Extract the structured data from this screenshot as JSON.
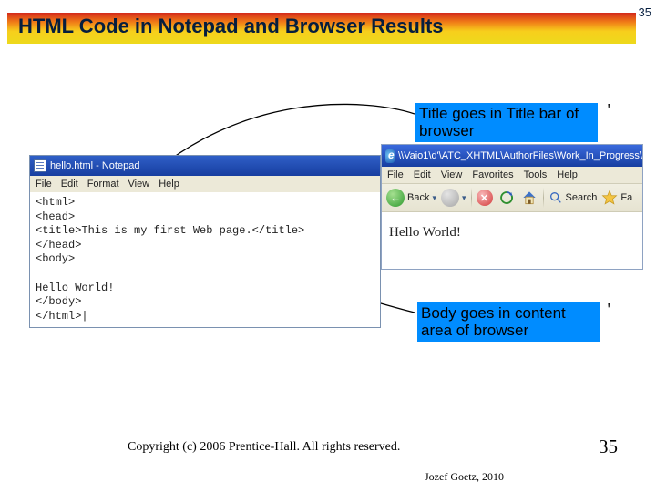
{
  "header": {
    "title": "HTML Code in Notepad and Browser Results",
    "page_number_top": "35"
  },
  "callouts": {
    "title_bar": "Title goes in Title bar of browser",
    "body_area": "Body goes in content area of browser"
  },
  "notepad": {
    "window_title": "hello.html - Notepad",
    "menu": {
      "file": "File",
      "edit": "Edit",
      "format": "Format",
      "view": "View",
      "help": "Help"
    },
    "code": "<html>\n<head>\n<title>This is my first Web page.</title>\n</head>\n<body>\n\nHello World!\n</body>\n</html>|"
  },
  "browser": {
    "address_bar": "\\\\Vaio1\\d'\\ATC_XHTML\\AuthorFiles\\Work_In_Progress\\",
    "menu": {
      "file": "File",
      "edit": "Edit",
      "view": "View",
      "favorites": "Favorites",
      "tools": "Tools",
      "help": "Help"
    },
    "toolbar": {
      "back": "Back",
      "search": "Search",
      "favorites": "Fa"
    },
    "content": "Hello World!"
  },
  "footer": {
    "copyright": "Copyright (c) 2006 Prentice-Hall. All rights reserved.",
    "author": "Jozef Goetz, 2010",
    "page_number": "35"
  }
}
